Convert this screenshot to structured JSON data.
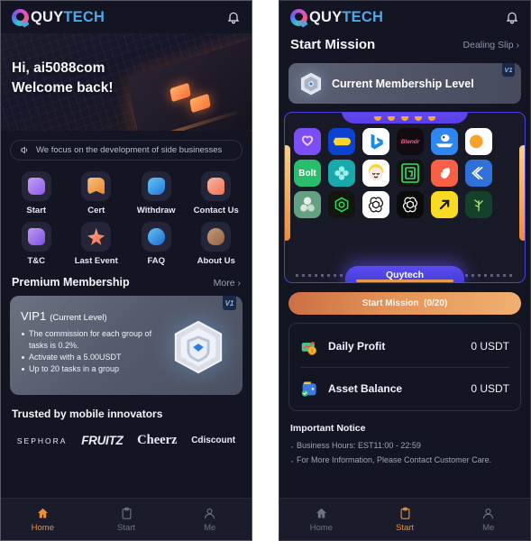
{
  "brand": {
    "name_a": "QUY",
    "name_b": "TECH",
    "logo_icon": "quytech-logo-icon",
    "bell_icon": "bell-icon"
  },
  "left": {
    "hero": {
      "greeting": "Hi, ai5088com",
      "subtitle": "Welcome back!"
    },
    "notice_bar": {
      "icon": "speaker-icon",
      "text": "We focus on the development of side businesses"
    },
    "quick_actions": [
      {
        "label": "Start",
        "icon": "document-start-icon"
      },
      {
        "label": "Cert",
        "icon": "certificate-icon"
      },
      {
        "label": "Withdraw",
        "icon": "withdraw-icon"
      },
      {
        "label": "Contact Us",
        "icon": "contact-us-icon"
      },
      {
        "label": "T&C",
        "icon": "terms-conditions-icon"
      },
      {
        "label": "Last Event",
        "icon": "last-event-star-icon"
      },
      {
        "label": "FAQ",
        "icon": "faq-icon"
      },
      {
        "label": "About Us",
        "icon": "about-us-people-icon"
      }
    ],
    "membership_section": {
      "title": "Premium Membership",
      "more": "More",
      "chevron": "chevron-right-icon"
    },
    "vip_card": {
      "level": "VIP1",
      "level_note": "(Current Level)",
      "tag": "V1",
      "badge_icon": "vip-shield-hex-icon",
      "benefits": [
        "The commission for each group of tasks is 0.2%.",
        "Activate with a 5.00USDT",
        "Up to 20 tasks in a group"
      ]
    },
    "trusted": {
      "title": "Trusted by mobile innovators",
      "brands": [
        "SEPHORA",
        "FRUITZ",
        "Cheerz",
        "Cdiscount"
      ]
    },
    "tabbar": [
      {
        "label": "Home",
        "icon": "home-icon",
        "active": true
      },
      {
        "label": "Start",
        "icon": "clipboard-icon",
        "active": false
      },
      {
        "label": "Me",
        "icon": "person-icon",
        "active": false
      }
    ]
  },
  "right": {
    "mission_head": {
      "title": "Start Mission",
      "link": "Dealing Slip",
      "chevron": "chevron-right-icon"
    },
    "membership_card": {
      "label": "Current Membership Level",
      "tag": "V1",
      "icon": "hex-badge-icon"
    },
    "carousel": {
      "top_dots_count": 5,
      "bottom_label": "Quytech",
      "apps": [
        {
          "name": "app-heart-purple",
          "bg": "#7c4ff5"
        },
        {
          "name": "app-tag-blue",
          "bg": "#0b42d2"
        },
        {
          "name": "app-bing-white",
          "bg": "#ffffff"
        },
        {
          "name": "app-blendr-black",
          "bg": "#130b12"
        },
        {
          "name": "app-bird-blue",
          "bg": "#2f86ef"
        },
        {
          "name": "app-orange-white",
          "bg": "#fdfdfd"
        },
        {
          "name": "app-bolt-green",
          "bg": "#2bbd6e"
        },
        {
          "name": "app-flower-teal",
          "bg": "#1aa9ab"
        },
        {
          "name": "app-smiley-yellow",
          "bg": "#fefefe"
        },
        {
          "name": "app-maze-black",
          "bg": "#101410"
        },
        {
          "name": "app-comet-red",
          "bg": "#f85f47"
        },
        {
          "name": "app-swirl-blue",
          "bg": "#2f71d8"
        },
        {
          "name": "app-leaf-sage",
          "bg": "#64a183"
        },
        {
          "name": "app-hex-green",
          "bg": "#12160f"
        },
        {
          "name": "app-openai-white",
          "bg": "#ffffff"
        },
        {
          "name": "app-openai-black",
          "bg": "#0b0b0b"
        },
        {
          "name": "app-arrow-yellow",
          "bg": "#fada22"
        },
        {
          "name": "app-plant-darkgreen",
          "bg": "#15412b"
        }
      ]
    },
    "start_button": {
      "label": "Start Mission",
      "counter": "(0/20)"
    },
    "stats": [
      {
        "name": "Daily Profit",
        "value": "0 USDT",
        "icon": "profit-chart-icon"
      },
      {
        "name": "Asset Balance",
        "value": "0 USDT",
        "icon": "wallet-icon"
      }
    ],
    "important_notice": {
      "title": "Important Notice",
      "items": [
        "Business Hours: EST11:00 - 22:59",
        "For More Information, Please Contact Customer Care."
      ]
    },
    "tabbar": [
      {
        "label": "Home",
        "icon": "home-icon",
        "active": false
      },
      {
        "label": "Start",
        "icon": "clipboard-icon",
        "active": true
      },
      {
        "label": "Me",
        "icon": "person-icon",
        "active": false
      }
    ]
  },
  "colors": {
    "accent_orange": "#e8903f",
    "accent_purple": "#5b4cf0",
    "bg": "#141522"
  }
}
